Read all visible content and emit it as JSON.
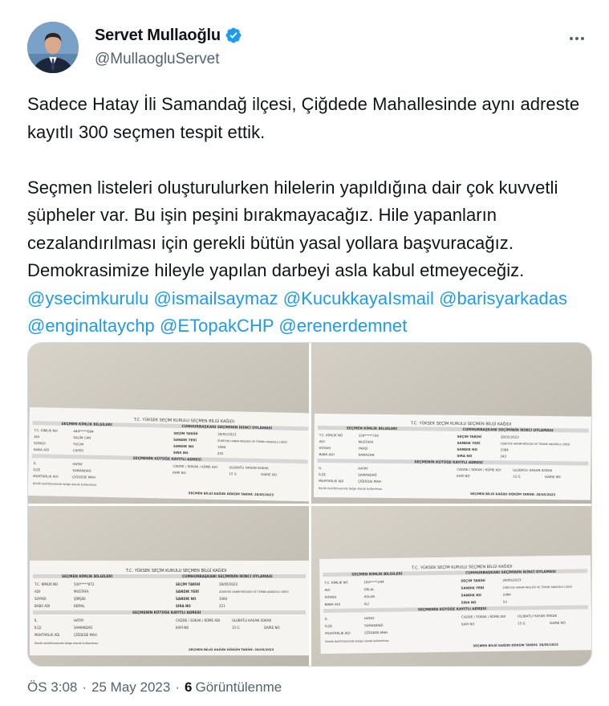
{
  "author": {
    "display_name": "Servet Mullaoğlu",
    "handle": "@MullaogluServet",
    "verified_icon": "verified-badge-icon",
    "avatar_icon": "avatar-photo"
  },
  "tweet": {
    "paragraph1": "Sadece Hatay İli Samandağ ilçesi, Çiğdede Mahallesinde aynı adreste kayıtlı 300 seçmen tespit ettik.",
    "paragraph2": "Seçmen listeleri oluşturulurken hilelerin yapıldığına dair çok kuvvetli şüpheler var. Bu işin peşini bırakmayacağız. Hile yapanların cezalandırılması için gerekli bütün yasal yollara başvuracağız. Demokrasimize hileyle yapılan darbeyi asla kabul etmeyeceğiz.",
    "mentions": [
      "@ysecimkurulu",
      "@ismailsaymaz",
      "@KucukkayaIsmail",
      "@barisyarkadas",
      "@enginaltaychp",
      "@ETopakCHP",
      "@erenerdemnet"
    ]
  },
  "documents": {
    "title": "T.C. YÜKSEK SEÇİM KURULU SEÇMEN BİLGİ KAĞIDI",
    "left_header": "SEÇMEN KİMLİK BİLGİLERİ",
    "right_header": "CUMHURBAŞKANI SEÇİMİNİN İKİNCİ OYLAMASI",
    "address_header": "SEÇMENİN KÜTÜĞE KAYITLI ADRESİ",
    "lbl_tc": "T.C. KİMLİK NO",
    "lbl_adi": "ADI",
    "lbl_soyadi": "SOYADI",
    "lbl_baba": "BABA ADI",
    "lbl_tarih": "SEÇİM TARİHİ",
    "lbl_yeri": "SANDIK YERİ",
    "lbl_sandik": "SANDIK NO",
    "lbl_sira": "SIRA NO",
    "lbl_il": "İL",
    "lbl_ilce": "İLÇE",
    "lbl_muhtarlik": "MUHTARLIK ADI",
    "lbl_cadde": "CADDE / SOKAK / KÜME ADI",
    "lbl_kapi": "KAPI NO",
    "lbl_daire": "DAİRE NO",
    "footer_left": "Kimlik belirtilmesinde belge olarak kullanılmaz.",
    "footer_right": "SEÇMEN BİLGİ KAĞIDI DÖKÜM TARİHİ: 28/05/2023",
    "election_date": "28/05/2023",
    "school": "ZÜBEYDE HANIM MESLEKİ VE TEKNİK ANADOLU LİSESİ",
    "il": "HATAY",
    "ilce": "SAMANDAĞ",
    "mahalle": "ÇİĞDEDE MAH",
    "street": "ULUBATLI HASAN SOKAK",
    "kapi": "15 G",
    "sandik": "1084",
    "people": [
      {
        "tc": "444*****894",
        "adi": "SALİM CAN",
        "soyadi": "YUCAK",
        "baba": "CAFER",
        "sira": "255"
      },
      {
        "tc": "159*****720",
        "adi": "MUSTAFA",
        "soyadi": "YAHŞİ",
        "baba": "RAMAZAN",
        "sira": "243"
      },
      {
        "tc": "540*****872",
        "adi": "MUSTAFA",
        "soyadi": "ŞİMŞEK",
        "baba": "KEMAL",
        "sira": "221"
      },
      {
        "tc": "164*****294",
        "adi": "DELAL",
        "soyadi": "ASLAN",
        "baba": "ALİ",
        "sira": "53"
      }
    ]
  },
  "footer": {
    "time": "ÖS 3:08",
    "separator": "·",
    "date": "25 May 2023",
    "views_count": "6",
    "views_label": "Görüntülenme"
  }
}
